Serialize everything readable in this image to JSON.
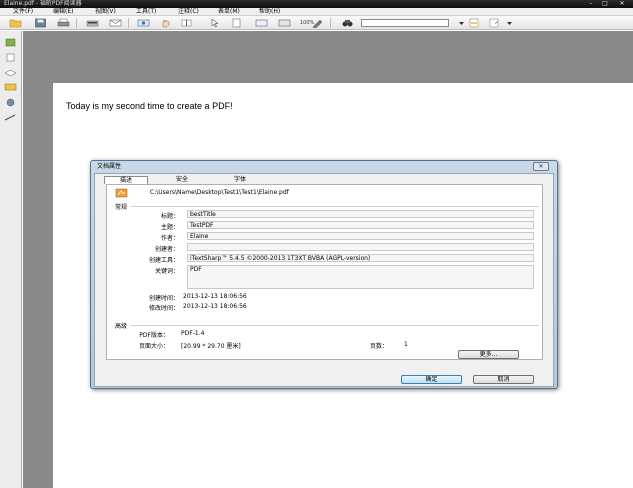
{
  "window": {
    "title": "Elaine.pdf - 福昕PDF阅读器",
    "controls": [
      "–",
      "□",
      "✕"
    ]
  },
  "menu": [
    {
      "label": "文件(F)"
    },
    {
      "label": "编辑(E)"
    },
    {
      "label": "视图(V)"
    },
    {
      "label": "工具(T)"
    },
    {
      "label": "注释(C)"
    },
    {
      "label": "表单(M)"
    },
    {
      "label": "帮助(H)"
    }
  ],
  "toolbar": {
    "zoom_label": "100%",
    "search_placeholder": ""
  },
  "document": {
    "text": "Today is my second time to create a PDF!"
  },
  "dialog": {
    "title": "文档属性",
    "close_label": "✕",
    "tabs": [
      {
        "label": "描述"
      },
      {
        "label": "安全"
      },
      {
        "label": "字体"
      }
    ],
    "file_path": "C:\\Users\\Name\\Desktop\\Test1\\Test1\\Elaine.pdf",
    "general_section": "常规",
    "fields": [
      {
        "label": "标题：",
        "value": "bestTitle"
      },
      {
        "label": "主题：",
        "value": "TestPDF"
      },
      {
        "label": "作者：",
        "value": "Elaine"
      },
      {
        "label": "创建者：",
        "value": ""
      },
      {
        "label": "创建工具：",
        "value": "iTextSharp™ 5.4.5 ©2000-2013 1T3XT BVBA (AGPL-version)"
      },
      {
        "label": "关键词：",
        "value": "PDF"
      }
    ],
    "created_label": "创建时间：",
    "created_value": "2013-12-13 18:06:56",
    "modified_label": "修改时间：",
    "modified_value": "2013-12-13 18:06:56",
    "advanced_section": "高级",
    "pdf_version_label": "PDF版本：",
    "pdf_version_value": "PDF-1.4",
    "page_size_label": "页面大小：",
    "page_size_value": "[20.99 * 29.70 厘米]",
    "page_count_label": "页数：",
    "page_count_value": "1",
    "more_button": "更多...",
    "ok_button": "确定",
    "cancel_button": "取消"
  }
}
